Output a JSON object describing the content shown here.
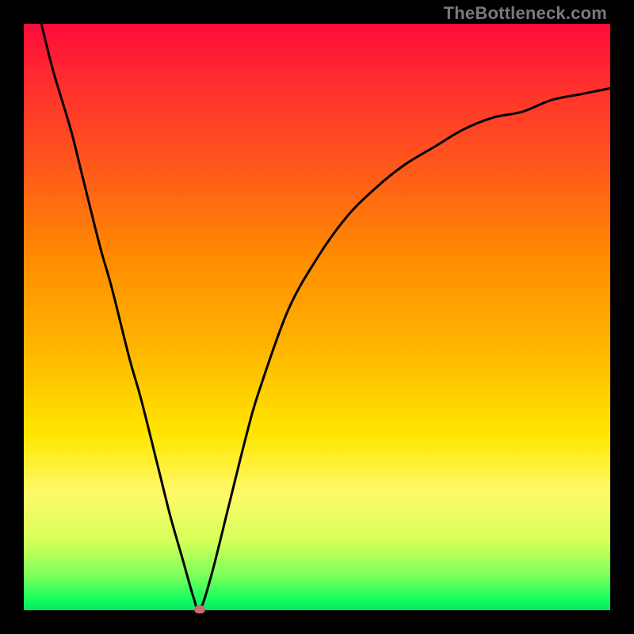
{
  "watermark": "TheBottleneck.com",
  "chart_data": {
    "type": "line",
    "title": "",
    "xlabel": "",
    "ylabel": "",
    "xlim": [
      0,
      100
    ],
    "ylim": [
      0,
      100
    ],
    "grid": false,
    "legend": false,
    "series": [
      {
        "name": "curve",
        "x": [
          3,
          5,
          8,
          10,
          13,
          15,
          18,
          20,
          23,
          25,
          27,
          29,
          30,
          32,
          35,
          38,
          40,
          45,
          50,
          55,
          60,
          65,
          70,
          75,
          80,
          85,
          90,
          95,
          100
        ],
        "values": [
          100,
          92,
          82,
          74,
          62,
          55,
          43,
          36,
          24,
          16,
          9,
          2,
          0,
          6,
          18,
          30,
          37,
          51,
          60,
          67,
          72,
          76,
          79,
          82,
          84,
          85,
          87,
          88,
          89
        ]
      }
    ],
    "min_point": {
      "x": 30,
      "y": 0
    },
    "background_gradient": {
      "top": "#ff0a3a",
      "bottom": "#00e865",
      "stops": [
        "#ff0a3a",
        "#ff5a1a",
        "#ffb400",
        "#fff96a",
        "#1aff5f"
      ]
    }
  },
  "colors": {
    "curve_stroke": "#000000",
    "frame": "#000000",
    "min_marker": "#c96d6d"
  }
}
